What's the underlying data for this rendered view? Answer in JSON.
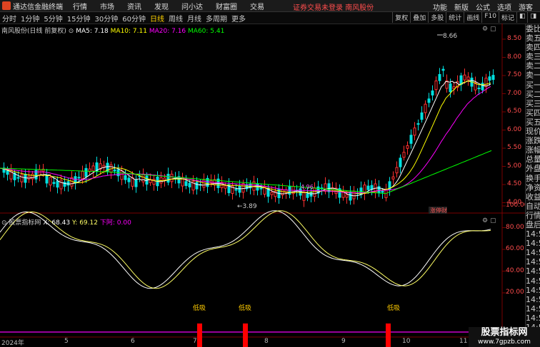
{
  "app": {
    "name": "通达信金融终端",
    "menu": [
      "行情",
      "市场",
      "资讯",
      "发现",
      "问小达",
      "财富圈",
      "交易"
    ],
    "notice": "证券交易未登录",
    "stock_short": "南风股份",
    "right_menu": [
      "功能",
      "新版",
      "公式",
      "选项",
      "游客"
    ]
  },
  "toolbar": {
    "periods": [
      "分时",
      "1分钟",
      "5分钟",
      "15分钟",
      "30分钟",
      "60分钟",
      "日线",
      "周线",
      "月线",
      "多周期",
      "更多"
    ],
    "active_period": "日线",
    "tools": [
      "复权",
      "叠加",
      "多股",
      "统计",
      "画线",
      "F10",
      "标记",
      "◧",
      "◨"
    ]
  },
  "main_chart": {
    "title": "南风股份(日线 前复权)",
    "ma": [
      {
        "label": "MA5: 7.18",
        "color": "#ffffff"
      },
      {
        "label": "MA10: 7.11",
        "color": "#ffff00"
      },
      {
        "label": "MA20: 7.16",
        "color": "#ff00ff"
      },
      {
        "label": "MA60: 5.41",
        "color": "#00ff00"
      }
    ],
    "y_ticks": [
      "8.50",
      "8.00",
      "7.50",
      "7.00",
      "6.50",
      "6.00",
      "5.50",
      "5.00",
      "4.50",
      "4.00"
    ],
    "high_label": "8.66",
    "low_label": "3.89",
    "tag": "涨停财",
    "price_tag": "4.96"
  },
  "indicator": {
    "title": "股票指标网",
    "x_label": "X: 68.43",
    "y_label": "Y: 69.12",
    "z_label": "下阿: 0.00",
    "y_ticks": [
      "100.00",
      "80.00",
      "60.00",
      "40.00",
      "20.00"
    ],
    "signal_label": "低吸"
  },
  "dates": [
    "2024年",
    "5",
    "6",
    "7",
    "8",
    "9",
    "10",
    "11"
  ],
  "side_panel": [
    "委比",
    "卖五",
    "卖四",
    "卖三",
    "卖二",
    "卖一",
    "买一",
    "买二",
    "买三",
    "买四",
    "买五",
    "现价",
    "涨跌",
    "涨幅",
    "总量",
    "外盘",
    "换手",
    "净资",
    "收益",
    "自动",
    "行情",
    "盘后",
    "14:5",
    "14:5",
    "14:5",
    "14:5",
    "14:5",
    "14:5",
    "14:5",
    "14:5",
    "14:5",
    "14:5",
    "14:5",
    "14:5"
  ],
  "watermark": {
    "line1": "股票指标网",
    "line2": "www.7gpzb.com"
  }
}
